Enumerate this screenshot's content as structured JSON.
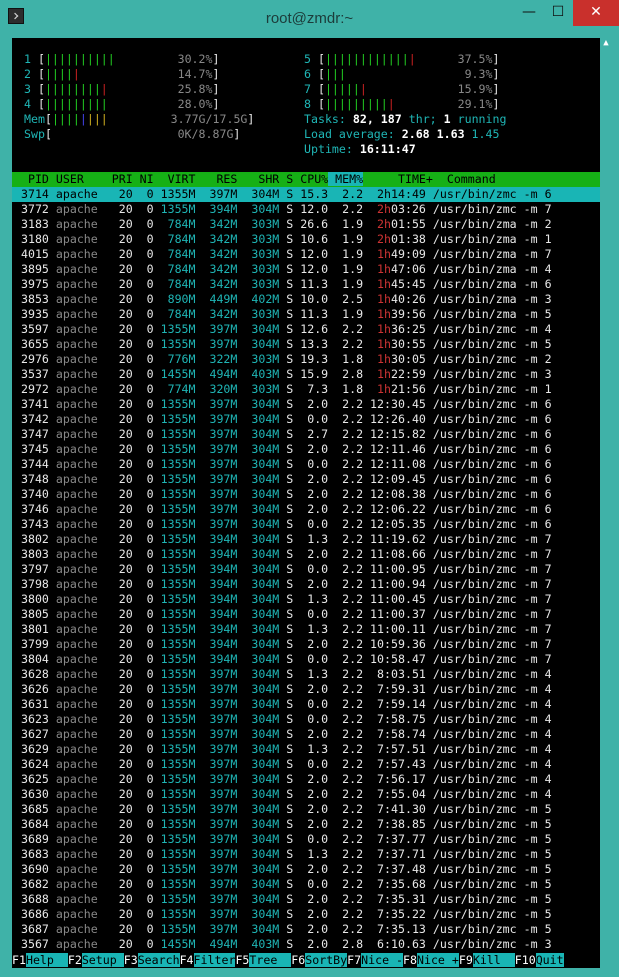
{
  "window": {
    "title": "root@zmdr:~",
    "min": "—",
    "max": "☐",
    "close": "✕"
  },
  "cpus_left": [
    {
      "num": "1",
      "bars": "||||||||||",
      "red": "",
      "pct": "30.2%"
    },
    {
      "num": "2",
      "bars": "||||",
      "red": "|",
      "pct": "14.7%"
    },
    {
      "num": "3",
      "bars": "||||||||",
      "red": "|",
      "pct": "25.8%"
    },
    {
      "num": "4",
      "bars": "|||||||||",
      "red": "",
      "pct": "28.0%"
    }
  ],
  "cpus_right": [
    {
      "num": "5",
      "bars": "||||||||||||",
      "red": "|",
      "pct": "37.5%"
    },
    {
      "num": "6",
      "bars": "|||",
      "red": "",
      "pct": "9.3%"
    },
    {
      "num": "7",
      "bars": "|||||",
      "red": "|",
      "pct": "15.9%"
    },
    {
      "num": "8",
      "bars": "|||||||||",
      "red": "|",
      "pct": "29.1%"
    }
  ],
  "mem": {
    "label": "Mem",
    "value": "3.77G/17.5G"
  },
  "swp": {
    "label": "Swp",
    "value": "0K/8.87G"
  },
  "tasks": {
    "label": "Tasks:",
    "tasks": "82,",
    "thr": "187",
    "thr_lbl": "thr;",
    "running": "1",
    "running_lbl": "running"
  },
  "load": {
    "label": "Load average:",
    "v1": "2.68",
    "v2": "1.63",
    "v3": "1.45"
  },
  "uptime": {
    "label": "Uptime:",
    "value": "16:11:47"
  },
  "columns": [
    "PID",
    "USER",
    "PRI",
    "NI",
    "VIRT",
    "RES",
    "SHR",
    "S",
    "CPU%",
    "MEM%",
    "TIME+",
    "Command"
  ],
  "processes": [
    [
      "3714",
      "apache",
      "20",
      "0",
      "1355M",
      "397M",
      "304M",
      "S",
      "15.3",
      "2.2",
      "2h",
      "14:49",
      "/usr/bin/zmc -m 6"
    ],
    [
      "3772",
      "apache",
      "20",
      "0",
      "1355M",
      "394M",
      "304M",
      "S",
      "12.0",
      "2.2",
      "2h",
      "03:26",
      "/usr/bin/zmc -m 7"
    ],
    [
      "3183",
      "apache",
      "20",
      "0",
      "784M",
      "342M",
      "303M",
      "S",
      "26.6",
      "1.9",
      "2h",
      "01:55",
      "/usr/bin/zma -m 2"
    ],
    [
      "3180",
      "apache",
      "20",
      "0",
      "784M",
      "342M",
      "303M",
      "S",
      "10.6",
      "1.9",
      "2h",
      "01:38",
      "/usr/bin/zma -m 1"
    ],
    [
      "4015",
      "apache",
      "20",
      "0",
      "784M",
      "342M",
      "303M",
      "S",
      "12.0",
      "1.9",
      "1h",
      "49:09",
      "/usr/bin/zma -m 7"
    ],
    [
      "3895",
      "apache",
      "20",
      "0",
      "784M",
      "342M",
      "303M",
      "S",
      "12.0",
      "1.9",
      "1h",
      "47:06",
      "/usr/bin/zma -m 4"
    ],
    [
      "3975",
      "apache",
      "20",
      "0",
      "784M",
      "342M",
      "303M",
      "S",
      "11.3",
      "1.9",
      "1h",
      "45:45",
      "/usr/bin/zma -m 6"
    ],
    [
      "3853",
      "apache",
      "20",
      "0",
      "890M",
      "449M",
      "402M",
      "S",
      "10.0",
      "2.5",
      "1h",
      "40:26",
      "/usr/bin/zma -m 3"
    ],
    [
      "3935",
      "apache",
      "20",
      "0",
      "784M",
      "342M",
      "303M",
      "S",
      "11.3",
      "1.9",
      "1h",
      "39:56",
      "/usr/bin/zma -m 5"
    ],
    [
      "3597",
      "apache",
      "20",
      "0",
      "1355M",
      "397M",
      "304M",
      "S",
      "12.6",
      "2.2",
      "1h",
      "36:25",
      "/usr/bin/zmc -m 4"
    ],
    [
      "3655",
      "apache",
      "20",
      "0",
      "1355M",
      "397M",
      "304M",
      "S",
      "13.3",
      "2.2",
      "1h",
      "30:55",
      "/usr/bin/zmc -m 5"
    ],
    [
      "2976",
      "apache",
      "20",
      "0",
      "776M",
      "322M",
      "303M",
      "S",
      "19.3",
      "1.8",
      "1h",
      "30:05",
      "/usr/bin/zmc -m 2"
    ],
    [
      "3537",
      "apache",
      "20",
      "0",
      "1455M",
      "494M",
      "403M",
      "S",
      "15.9",
      "2.8",
      "1h",
      "22:59",
      "/usr/bin/zmc -m 3"
    ],
    [
      "2972",
      "apache",
      "20",
      "0",
      "774M",
      "320M",
      "303M",
      "S",
      "7.3",
      "1.8",
      "1h",
      "21:56",
      "/usr/bin/zmc -m 1"
    ],
    [
      "3741",
      "apache",
      "20",
      "0",
      "1355M",
      "397M",
      "304M",
      "S",
      "2.0",
      "2.2",
      "",
      "12:30.45",
      "/usr/bin/zmc -m 6"
    ],
    [
      "3742",
      "apache",
      "20",
      "0",
      "1355M",
      "397M",
      "304M",
      "S",
      "0.0",
      "2.2",
      "",
      "12:26.40",
      "/usr/bin/zmc -m 6"
    ],
    [
      "3747",
      "apache",
      "20",
      "0",
      "1355M",
      "397M",
      "304M",
      "S",
      "2.7",
      "2.2",
      "",
      "12:15.82",
      "/usr/bin/zmc -m 6"
    ],
    [
      "3745",
      "apache",
      "20",
      "0",
      "1355M",
      "397M",
      "304M",
      "S",
      "2.0",
      "2.2",
      "",
      "12:11.46",
      "/usr/bin/zmc -m 6"
    ],
    [
      "3744",
      "apache",
      "20",
      "0",
      "1355M",
      "397M",
      "304M",
      "S",
      "0.0",
      "2.2",
      "",
      "12:11.08",
      "/usr/bin/zmc -m 6"
    ],
    [
      "3748",
      "apache",
      "20",
      "0",
      "1355M",
      "397M",
      "304M",
      "S",
      "2.0",
      "2.2",
      "",
      "12:09.45",
      "/usr/bin/zmc -m 6"
    ],
    [
      "3740",
      "apache",
      "20",
      "0",
      "1355M",
      "397M",
      "304M",
      "S",
      "2.0",
      "2.2",
      "",
      "12:08.38",
      "/usr/bin/zmc -m 6"
    ],
    [
      "3746",
      "apache",
      "20",
      "0",
      "1355M",
      "397M",
      "304M",
      "S",
      "2.0",
      "2.2",
      "",
      "12:06.22",
      "/usr/bin/zmc -m 6"
    ],
    [
      "3743",
      "apache",
      "20",
      "0",
      "1355M",
      "397M",
      "304M",
      "S",
      "0.0",
      "2.2",
      "",
      "12:05.35",
      "/usr/bin/zmc -m 6"
    ],
    [
      "3802",
      "apache",
      "20",
      "0",
      "1355M",
      "394M",
      "304M",
      "S",
      "1.3",
      "2.2",
      "",
      "11:19.62",
      "/usr/bin/zmc -m 7"
    ],
    [
      "3803",
      "apache",
      "20",
      "0",
      "1355M",
      "394M",
      "304M",
      "S",
      "2.0",
      "2.2",
      "",
      "11:08.66",
      "/usr/bin/zmc -m 7"
    ],
    [
      "3797",
      "apache",
      "20",
      "0",
      "1355M",
      "394M",
      "304M",
      "S",
      "0.0",
      "2.2",
      "",
      "11:00.95",
      "/usr/bin/zmc -m 7"
    ],
    [
      "3798",
      "apache",
      "20",
      "0",
      "1355M",
      "394M",
      "304M",
      "S",
      "2.0",
      "2.2",
      "",
      "11:00.94",
      "/usr/bin/zmc -m 7"
    ],
    [
      "3800",
      "apache",
      "20",
      "0",
      "1355M",
      "394M",
      "304M",
      "S",
      "1.3",
      "2.2",
      "",
      "11:00.45",
      "/usr/bin/zmc -m 7"
    ],
    [
      "3805",
      "apache",
      "20",
      "0",
      "1355M",
      "394M",
      "304M",
      "S",
      "0.0",
      "2.2",
      "",
      "11:00.37",
      "/usr/bin/zmc -m 7"
    ],
    [
      "3801",
      "apache",
      "20",
      "0",
      "1355M",
      "394M",
      "304M",
      "S",
      "1.3",
      "2.2",
      "",
      "11:00.11",
      "/usr/bin/zmc -m 7"
    ],
    [
      "3799",
      "apache",
      "20",
      "0",
      "1355M",
      "394M",
      "304M",
      "S",
      "2.0",
      "2.2",
      "",
      "10:59.36",
      "/usr/bin/zmc -m 7"
    ],
    [
      "3804",
      "apache",
      "20",
      "0",
      "1355M",
      "394M",
      "304M",
      "S",
      "0.0",
      "2.2",
      "",
      "10:58.47",
      "/usr/bin/zmc -m 7"
    ],
    [
      "3628",
      "apache",
      "20",
      "0",
      "1355M",
      "397M",
      "304M",
      "S",
      "1.3",
      "2.2",
      "",
      "8:03.51",
      "/usr/bin/zmc -m 4"
    ],
    [
      "3626",
      "apache",
      "20",
      "0",
      "1355M",
      "397M",
      "304M",
      "S",
      "2.0",
      "2.2",
      "",
      "7:59.31",
      "/usr/bin/zmc -m 4"
    ],
    [
      "3631",
      "apache",
      "20",
      "0",
      "1355M",
      "397M",
      "304M",
      "S",
      "0.0",
      "2.2",
      "",
      "7:59.14",
      "/usr/bin/zmc -m 4"
    ],
    [
      "3623",
      "apache",
      "20",
      "0",
      "1355M",
      "397M",
      "304M",
      "S",
      "0.0",
      "2.2",
      "",
      "7:58.75",
      "/usr/bin/zmc -m 4"
    ],
    [
      "3627",
      "apache",
      "20",
      "0",
      "1355M",
      "397M",
      "304M",
      "S",
      "2.0",
      "2.2",
      "",
      "7:58.74",
      "/usr/bin/zmc -m 4"
    ],
    [
      "3629",
      "apache",
      "20",
      "0",
      "1355M",
      "397M",
      "304M",
      "S",
      "1.3",
      "2.2",
      "",
      "7:57.51",
      "/usr/bin/zmc -m 4"
    ],
    [
      "3624",
      "apache",
      "20",
      "0",
      "1355M",
      "397M",
      "304M",
      "S",
      "0.0",
      "2.2",
      "",
      "7:57.43",
      "/usr/bin/zmc -m 4"
    ],
    [
      "3625",
      "apache",
      "20",
      "0",
      "1355M",
      "397M",
      "304M",
      "S",
      "2.0",
      "2.2",
      "",
      "7:56.17",
      "/usr/bin/zmc -m 4"
    ],
    [
      "3630",
      "apache",
      "20",
      "0",
      "1355M",
      "397M",
      "304M",
      "S",
      "2.0",
      "2.2",
      "",
      "7:55.04",
      "/usr/bin/zmc -m 4"
    ],
    [
      "3685",
      "apache",
      "20",
      "0",
      "1355M",
      "397M",
      "304M",
      "S",
      "2.0",
      "2.2",
      "",
      "7:41.30",
      "/usr/bin/zmc -m 5"
    ],
    [
      "3684",
      "apache",
      "20",
      "0",
      "1355M",
      "397M",
      "304M",
      "S",
      "2.0",
      "2.2",
      "",
      "7:38.85",
      "/usr/bin/zmc -m 5"
    ],
    [
      "3689",
      "apache",
      "20",
      "0",
      "1355M",
      "397M",
      "304M",
      "S",
      "0.0",
      "2.2",
      "",
      "7:37.77",
      "/usr/bin/zmc -m 5"
    ],
    [
      "3683",
      "apache",
      "20",
      "0",
      "1355M",
      "397M",
      "304M",
      "S",
      "1.3",
      "2.2",
      "",
      "7:37.71",
      "/usr/bin/zmc -m 5"
    ],
    [
      "3690",
      "apache",
      "20",
      "0",
      "1355M",
      "397M",
      "304M",
      "S",
      "2.0",
      "2.2",
      "",
      "7:37.48",
      "/usr/bin/zmc -m 5"
    ],
    [
      "3682",
      "apache",
      "20",
      "0",
      "1355M",
      "397M",
      "304M",
      "S",
      "0.0",
      "2.2",
      "",
      "7:35.68",
      "/usr/bin/zmc -m 5"
    ],
    [
      "3688",
      "apache",
      "20",
      "0",
      "1355M",
      "397M",
      "304M",
      "S",
      "2.0",
      "2.2",
      "",
      "7:35.31",
      "/usr/bin/zmc -m 5"
    ],
    [
      "3686",
      "apache",
      "20",
      "0",
      "1355M",
      "397M",
      "304M",
      "S",
      "2.0",
      "2.2",
      "",
      "7:35.22",
      "/usr/bin/zmc -m 5"
    ],
    [
      "3687",
      "apache",
      "20",
      "0",
      "1355M",
      "397M",
      "304M",
      "S",
      "2.0",
      "2.2",
      "",
      "7:35.13",
      "/usr/bin/zmc -m 5"
    ],
    [
      "3567",
      "apache",
      "20",
      "0",
      "1455M",
      "494M",
      "403M",
      "S",
      "2.0",
      "2.8",
      "",
      "6:10.63",
      "/usr/bin/zmc -m 3"
    ]
  ],
  "fkeys": [
    {
      "key": "F1",
      "label": "Help  "
    },
    {
      "key": "F2",
      "label": "Setup "
    },
    {
      "key": "F3",
      "label": "Search"
    },
    {
      "key": "F4",
      "label": "Filter"
    },
    {
      "key": "F5",
      "label": "Tree  "
    },
    {
      "key": "F6",
      "label": "SortBy"
    },
    {
      "key": "F7",
      "label": "Nice -"
    },
    {
      "key": "F8",
      "label": "Nice +"
    },
    {
      "key": "F9",
      "label": "Kill  "
    },
    {
      "key": "F10",
      "label": "Quit"
    }
  ]
}
